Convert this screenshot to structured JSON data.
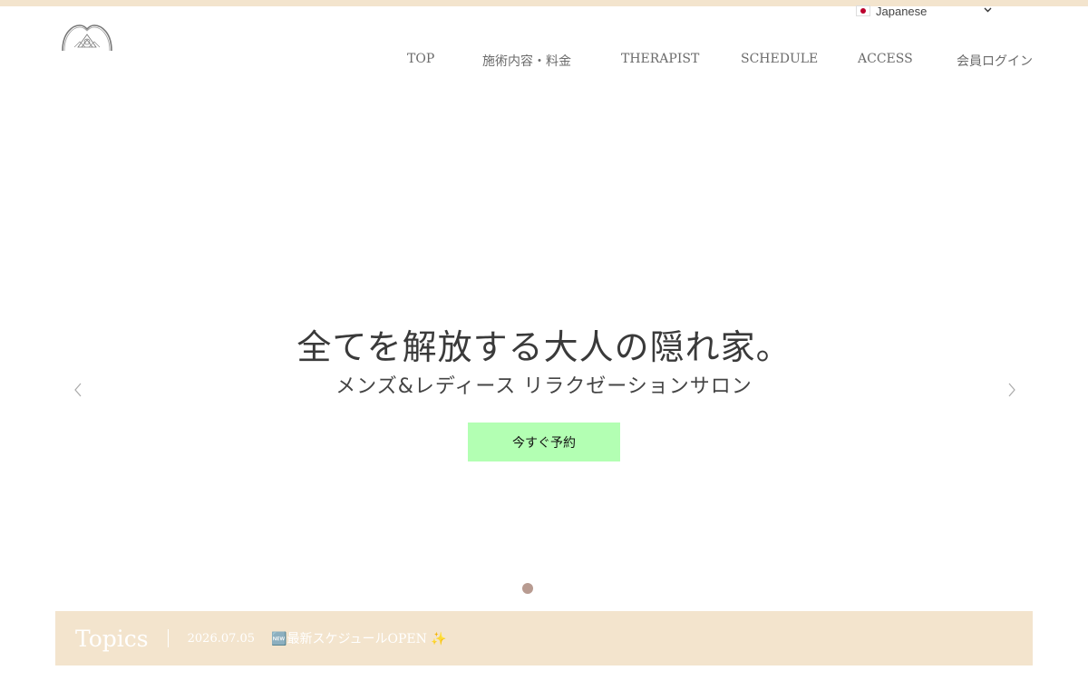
{
  "language": {
    "selected": "Japanese",
    "flag_icon": "japan-flag-icon"
  },
  "nav": {
    "items": [
      {
        "label": "TOP"
      },
      {
        "label": "施術内容・料金"
      },
      {
        "label": "THERAPIST"
      },
      {
        "label": "SCHEDULE"
      },
      {
        "label": "ACCESS"
      },
      {
        "label": "会員ログイン"
      }
    ]
  },
  "hero": {
    "title": "全てを解放する大人の隠れ家。",
    "subtitle": "メンズ&レディース リラクゼーションサロン",
    "cta_label": "今すぐ予約",
    "slide_count": 1,
    "active_slide": 1
  },
  "topics": {
    "title": "Topics",
    "date": "2026.07.05",
    "text": "🆕最新スケジュールOPEN ✨"
  },
  "colors": {
    "accent_stripe": "#f3e4cd",
    "cta_background": "#b3ffb3",
    "slider_dot": "#b89b91",
    "topics_background": "#f3e4cd"
  }
}
